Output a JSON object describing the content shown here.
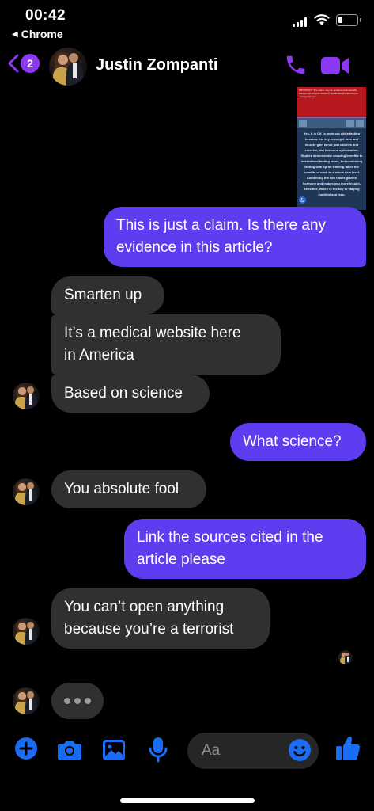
{
  "status_bar": {
    "time": "00:42",
    "back_app": "Chrome"
  },
  "header": {
    "unread_count": "2",
    "contact_name": "Justin Zompanti"
  },
  "shared_image": {
    "banner_text": "IMPORTANT: this article may be updated automatically. Always consult your doctor or healthcare provider before making changes.",
    "body_text": "Yes, it is OK to work out while fasting because the key to weight loss and muscle gain is not just calories and exercise, but hormone optimization. Studies demonstrate amazing benefits to intermittent fasting alone, but combining fasting with sprint training takes the benefits of each to a whole new level. Combining the two raises growth hormone and makes you more insulin-sensitive, which is the key to staying youthful and lean."
  },
  "messages": [
    {
      "from": "me",
      "text": "This is just a claim. Is there any\nevidence in this article?"
    },
    {
      "from": "them",
      "text": "Smarten up"
    },
    {
      "from": "them",
      "text": "It’s a medical website here\nin America"
    },
    {
      "from": "them",
      "text": "Based on science"
    },
    {
      "from": "me",
      "text": "What science?"
    },
    {
      "from": "them",
      "text": "You absolute fool"
    },
    {
      "from": "me",
      "text": "Link the sources cited in the\narticle please"
    },
    {
      "from": "them",
      "text": "You can’t open anything\nbecause you’re a terrorist"
    }
  ],
  "composer": {
    "placeholder": "Aa"
  },
  "colors": {
    "accent": "#8a39f1",
    "outgoing_bubble": "#5e3cf0",
    "incoming_bubble": "#303030",
    "icon_blue": "#1a6cf5"
  }
}
